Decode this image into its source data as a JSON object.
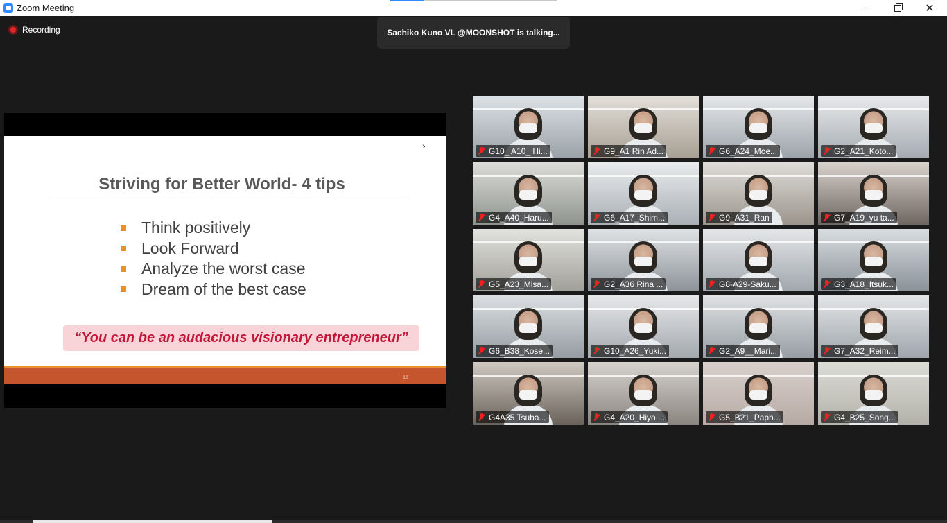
{
  "window": {
    "title": "Zoom Meeting",
    "close_glyph": "✕"
  },
  "recording": {
    "label": "Recording"
  },
  "talking_banner": "Sachiko Kuno VL @MOONSHOT is talking...",
  "slide": {
    "chevron": "›",
    "title": "Striving for Better World- 4 tips",
    "bullets": [
      "Think positively",
      "Look Forward",
      "Analyze the worst case",
      "Dream of the best case"
    ],
    "quote": "“You can be an audacious visionary entrepreneur”",
    "page_number": "15"
  },
  "participants": [
    "G10_ A10_ Hi...",
    "G9_A1 Rin Ad...",
    "G6_A24_Moe...",
    "G2_A21_Koto...",
    "G4_A40_Haru...",
    "G6_A17_Shim...",
    "G9_A31_Ran",
    "G7_A19_yu ta...",
    "G5_A23_Misa...",
    "G2_A36 Rina ...",
    "G8-A29-Saku...",
    "G3_A18_Itsuk...",
    "G6_B38_Kose...",
    "G10_A26_Yuki...",
    "G2_A9__Mari...",
    "G7_A32_Reim...",
    "G4A35 Tsuba...",
    "G4_A20_Hiyo ...",
    "G5_B21_Paph...",
    "G4_B25_Song..."
  ],
  "colors": {
    "background": "#1a1a1a",
    "accent": "#2d8cff",
    "recording": "#e02828",
    "muted_mic": "#e22222",
    "slide_quote": "#c3173a",
    "slide_footer": "#c4552c"
  }
}
